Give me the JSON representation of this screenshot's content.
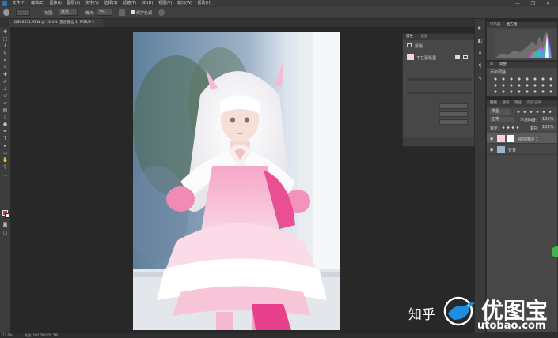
{
  "menubar": {
    "items": [
      "文件(F)",
      "编辑(E)",
      "图像(I)",
      "图层(L)",
      "文字(Y)",
      "选择(S)",
      "滤镜(T)",
      "3D(D)",
      "视图(V)",
      "窗口(W)",
      "帮助(H)"
    ],
    "window_controls": "—  ❐  ✕"
  },
  "optionsbar": {
    "mode_label": "范围:",
    "mode_value": "高光",
    "exposure_label": "曝光:",
    "exposure_value": "7%",
    "protect_label": "保护色调"
  },
  "document": {
    "tab_title": "DSC6551.ARW @ 13.4% (图层描边 1, RGB/8*)",
    "status_zoom": "13.4%",
    "status_doc": "文档: 102.7M/205.7M"
  },
  "properties_panel": {
    "tabs": [
      "属性",
      "信息"
    ],
    "subtitle": "蒙版",
    "layer_label": "不在蒙版里"
  },
  "histogram_panel": {
    "tabs": [
      "导航器",
      "直方图"
    ]
  },
  "adjustments_panel": {
    "tabs": [
      "库",
      "调整"
    ],
    "title": "添加调整"
  },
  "layers_panel": {
    "tabs": [
      "图层",
      "通道",
      "路径",
      "历史记录"
    ],
    "kind_label": "类型",
    "blend_mode": "正常",
    "opacity_label": "不透明度:",
    "opacity_value": "100%",
    "lock_label": "锁定:",
    "fill_label": "填充:",
    "fill_value": "100%",
    "layers": [
      {
        "name": "图层描边 1"
      },
      {
        "name": "背景"
      }
    ]
  },
  "watermark": {
    "zhihu": "知乎",
    "title": "优图宝",
    "url": "utobao.com"
  }
}
